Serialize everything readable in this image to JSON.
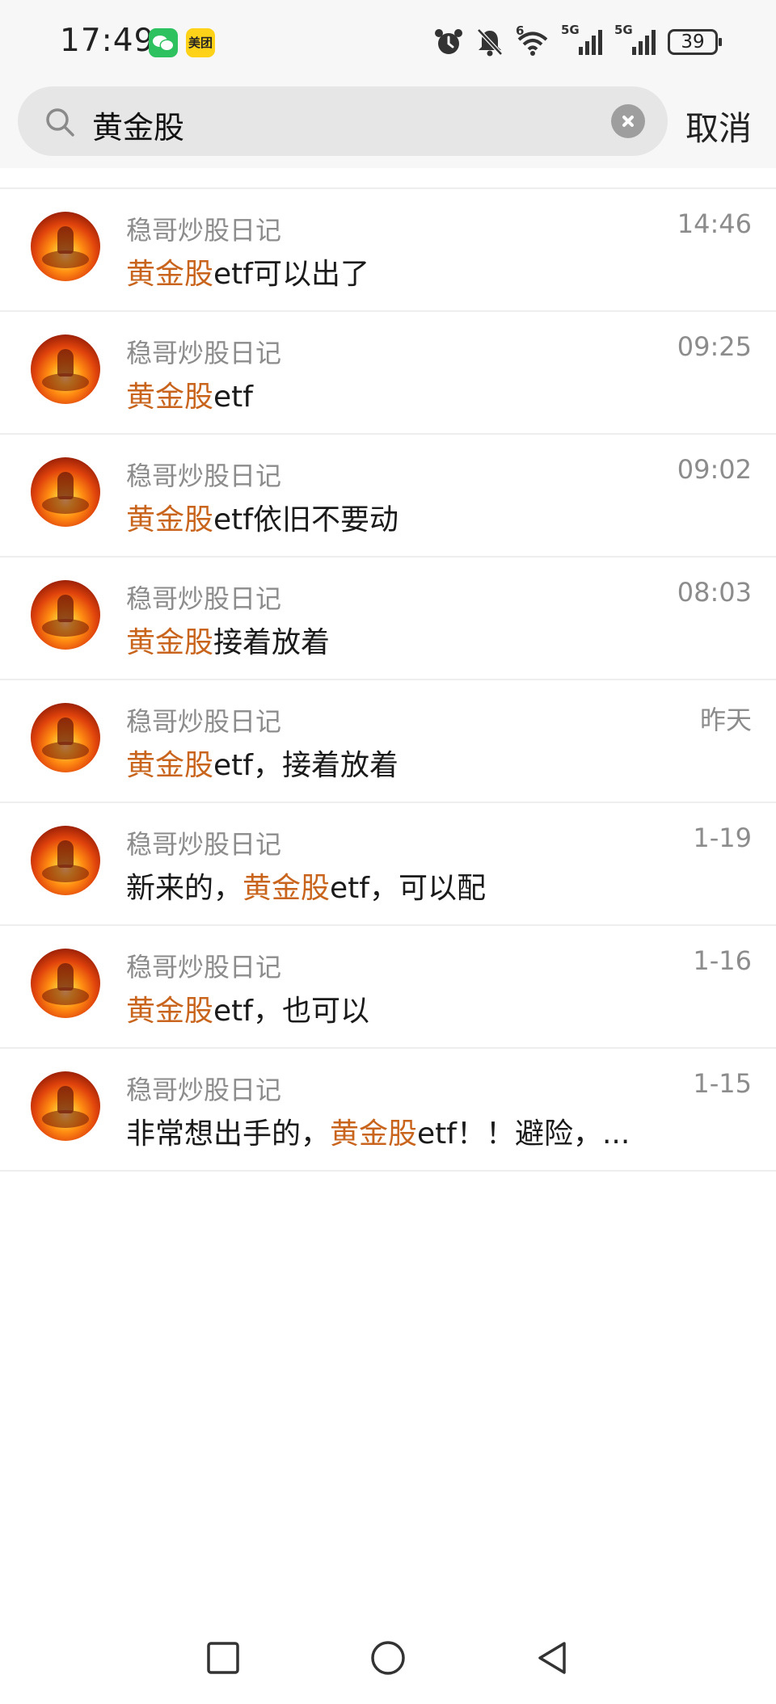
{
  "status_bar": {
    "time": "17:49",
    "apps": [
      {
        "name": "wechat-notification-icon",
        "color": "#2dc160"
      },
      {
        "name": "meituan-notification-icon",
        "label": "美团",
        "color": "#ffd21a"
      }
    ],
    "icons": [
      "alarm-icon",
      "mute-icon",
      "wifi-icon",
      "signal-5g-icon",
      "signal-5g-icon"
    ],
    "wifi_label": "6",
    "network_labels": [
      "5G",
      "5G"
    ],
    "battery": "39"
  },
  "search": {
    "query": "黄金股",
    "cancel_label": "取消"
  },
  "colors": {
    "highlight": "#c8641c",
    "meta_text": "#8c8c8c",
    "body_text": "#1a1a1a"
  },
  "results": [
    {
      "sender": "稳哥炒股日记",
      "time": "14:46",
      "pre": "",
      "hl": "黄金股",
      "post": "etf可以出了"
    },
    {
      "sender": "稳哥炒股日记",
      "time": "09:25",
      "pre": "",
      "hl": "黄金股",
      "post": "etf"
    },
    {
      "sender": "稳哥炒股日记",
      "time": "09:02",
      "pre": "",
      "hl": "黄金股",
      "post": "etf依旧不要动"
    },
    {
      "sender": "稳哥炒股日记",
      "time": "08:03",
      "pre": "",
      "hl": "黄金股",
      "post": "接着放着"
    },
    {
      "sender": "稳哥炒股日记",
      "time": "昨天",
      "pre": "",
      "hl": "黄金股",
      "post": "etf，接着放着"
    },
    {
      "sender": "稳哥炒股日记",
      "time": "1-19",
      "pre": "新来的，",
      "hl": "黄金股",
      "post": "etf，可以配"
    },
    {
      "sender": "稳哥炒股日记",
      "time": "1-16",
      "pre": "",
      "hl": "黄金股",
      "post": "etf，也可以"
    },
    {
      "sender": "稳哥炒股日记",
      "time": "1-15",
      "pre": "非常想出手的，",
      "hl": "黄金股",
      "post": "etf！！避险，..."
    }
  ],
  "nav": [
    "recents-square-icon",
    "home-circle-icon",
    "back-triangle-icon"
  ]
}
